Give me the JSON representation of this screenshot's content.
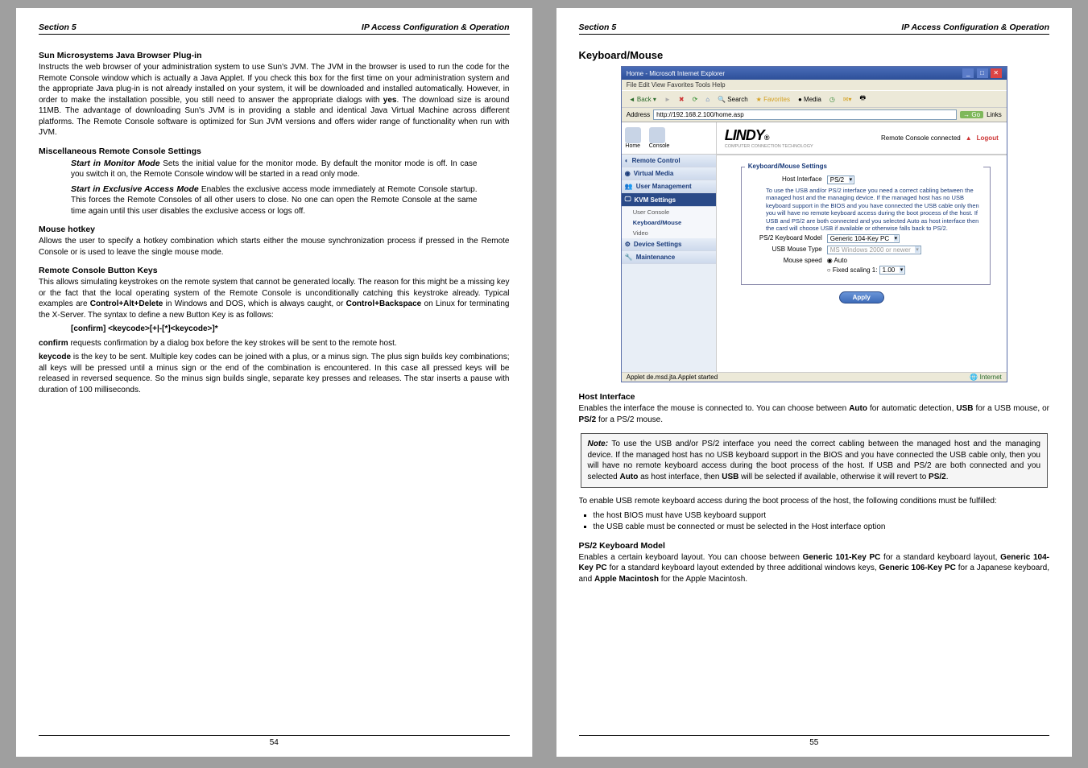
{
  "left": {
    "header": {
      "section": "Section 5",
      "title": "IP Access Configuration & Operation"
    },
    "s1_heading": "Sun Microsystems Java Browser Plug-in",
    "s1_body": "Instructs the web browser of your administration system to use Sun's JVM. The JVM in the browser is used to run the code for the Remote Console window which is actually a Java Applet. If you check this box for the first time on your administration system and the appropriate Java plug-in is not already installed on your system, it will be downloaded and installed automatically. However, in order to make the installation possible, you still need to answer the appropriate dialogs with yes. The download size is around 11MB. The advantage of downloading Sun's JVM is in providing a stable and identical Java Virtual Machine across different platforms. The Remote Console software is optimized for Sun JVM versions and offers wider range of functionality when run with JVM.",
    "s2_heading": "Miscellaneous Remote Console Settings",
    "s2_item1_lead": "Start in Monitor Mode",
    "s2_item1_body": " Sets the initial value for the monitor mode. By default the monitor mode is off. In case you switch it on, the Remote Console window will be started in a read only mode.",
    "s2_item2_lead": "Start in Exclusive Access Mode",
    "s2_item2_body": " Enables the exclusive access mode immediately at Remote Console startup. This forces the Remote Consoles of all other users to close. No one can open the Remote Console at the same time again until this user disables the exclusive access or logs off.",
    "s3_heading": "Mouse hotkey",
    "s3_body": "Allows the user to specify a hotkey combination which starts either the mouse synchronization process if pressed in the Remote Console or is used to leave the single mouse mode.",
    "s4_heading": "Remote Console Button Keys",
    "s4_body": "This allows simulating keystrokes on the remote system that cannot be generated locally. The reason for this might be a missing key or the fact that the local operating system of the Remote Console is unconditionally catching this keystroke already. Typical examples are Control+Alt+Delete in Windows and DOS, which is always caught, or Control+Backspace on Linux for terminating the X-Server. The syntax to define a new Button Key is as follows:",
    "s4_syntax": "[confirm] <keycode>[+|-[*]<keycode>]*",
    "s4_confirm_body": "confirm requests confirmation by a dialog box before the key strokes will be sent to the remote host.",
    "s4_keycode_body": "keycode is the key to be sent. Multiple key codes can be joined with a plus, or a minus sign. The plus sign builds key combinations; all keys will be pressed until a minus sign or the end of the combination is encountered. In this case all pressed keys will be released in reversed sequence. So the minus sign builds single, separate key presses and releases. The star inserts a pause with duration of 100 milliseconds.",
    "pageno": "54"
  },
  "right": {
    "header": {
      "section": "Section 5",
      "title": "IP Access Configuration & Operation"
    },
    "h1": "Keyboard/Mouse",
    "shot": {
      "window_title": "Home - Microsoft Internet Explorer",
      "menu": "File   Edit   View   Favorites   Tools   Help",
      "back": "Back",
      "search": "Search",
      "fav": "Favorites",
      "media": "Media",
      "addr_label": "Address",
      "addr_value": "http://192.168.2.100/home.asp",
      "go": "Go",
      "links": "Links",
      "brand": "LINDY",
      "brand_sub": "COMPUTER CONNECTION TECHNOLOGY",
      "status_conn": "Remote Console connected",
      "logout": "Logout",
      "home": "Home",
      "console": "Console",
      "side": {
        "remote": "Remote Control",
        "vmedia": "Virtual Media",
        "usermgmt": "User Management",
        "kvm": "KVM Settings",
        "userconsole": "User Console",
        "kbm": "Keyboard/Mouse",
        "video": "Video",
        "devset": "Device Settings",
        "maint": "Maintenance"
      },
      "fs_legend": "Keyboard/Mouse Settings",
      "host_if_lbl": "Host Interface",
      "host_if_val": "PS/2",
      "hint": "To use the USB and/or PS/2 interface you need a correct cabling between the managed host and the managing device. If the managed host has no USB keyboard support in the BIOS and you have connected the USB cable only then you will have no remote keyboard access during the boot process of the host. If USB and PS/2 are both connected and you selected Auto as host interface then the card will choose USB if available or otherwise falls back to PS/2.",
      "ps2_lbl": "PS/2 Keyboard Model",
      "ps2_val": "Generic 104-Key PC",
      "usb_lbl": "USB Mouse Type",
      "usb_val": "MS Windows 2000 or newer",
      "mspd_lbl": "Mouse speed",
      "mspd_auto": "Auto",
      "mspd_fixed": "Fixed scaling 1:",
      "mspd_fixed_val": "1.00",
      "apply": "Apply",
      "status_left": "Applet de.msd.jta.Applet started",
      "status_right": "Internet"
    },
    "hi_heading": "Host Interface",
    "hi_body": "Enables the interface the mouse is connected to. You can choose between Auto for automatic detection, USB for a USB mouse, or PS/2 for a PS/2 mouse.",
    "note_body": "Note: To use the USB and/or PS/2 interface you need the correct cabling between the managed host and the managing device. If the managed host has no USB keyboard support in the BIOS and you have connected the USB cable only, then you will have no remote keyboard access during the boot process of the host. If USB and PS/2 are both connected and you selected Auto as host interface, then USB will be selected if available, otherwise it will revert to PS/2.",
    "enable_body": "To enable USB remote keyboard access during the boot process of the host, the following conditions must be fulfilled:",
    "bullet1": "the host BIOS must have USB keyboard support",
    "bullet2": "the USB cable must be connected or must be selected in the Host interface option",
    "ps2_heading": "PS/2 Keyboard Model",
    "ps2_body": "Enables a certain keyboard layout. You can choose between Generic 101-Key PC for a standard keyboard layout, Generic 104-Key PC for a standard keyboard layout extended by three additional windows keys, Generic 106-Key PC for a Japanese keyboard, and Apple Macintosh for the Apple Macintosh.",
    "pageno": "55"
  }
}
